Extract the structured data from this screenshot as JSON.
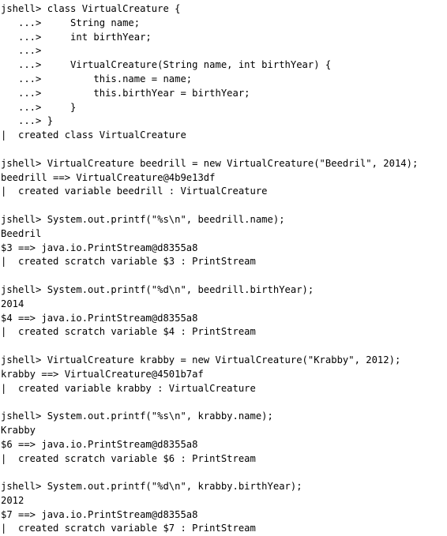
{
  "terminal": {
    "app_name": "jshell",
    "background_color": "#ffffff",
    "text_color": "#000000",
    "prompt": "jshell>",
    "continuation_prompt": "...>",
    "feedback_marker": "|",
    "lines": [
      "jshell> class VirtualCreature {",
      "   ...>     String name;",
      "   ...>     int birthYear;",
      "   ...>",
      "   ...>     VirtualCreature(String name, int birthYear) {",
      "   ...>         this.name = name;",
      "   ...>         this.birthYear = birthYear;",
      "   ...>     }",
      "   ...> }",
      "|  created class VirtualCreature",
      "",
      "jshell> VirtualCreature beedrill = new VirtualCreature(\"Beedril\", 2014);",
      "beedrill ==> VirtualCreature@4b9e13df",
      "|  created variable beedrill : VirtualCreature",
      "",
      "jshell> System.out.printf(\"%s\\n\", beedrill.name);",
      "Beedril",
      "$3 ==> java.io.PrintStream@d8355a8",
      "|  created scratch variable $3 : PrintStream",
      "",
      "jshell> System.out.printf(\"%d\\n\", beedrill.birthYear);",
      "2014",
      "$4 ==> java.io.PrintStream@d8355a8",
      "|  created scratch variable $4 : PrintStream",
      "",
      "jshell> VirtualCreature krabby = new VirtualCreature(\"Krabby\", 2012);",
      "krabby ==> VirtualCreature@4501b7af",
      "|  created variable krabby : VirtualCreature",
      "",
      "jshell> System.out.printf(\"%s\\n\", krabby.name);",
      "Krabby",
      "$6 ==> java.io.PrintStream@d8355a8",
      "|  created scratch variable $6 : PrintStream",
      "",
      "jshell> System.out.printf(\"%d\\n\", krabby.birthYear);",
      "2012",
      "$7 ==> java.io.PrintStream@d8355a8",
      "|  created scratch variable $7 : PrintStream"
    ]
  }
}
